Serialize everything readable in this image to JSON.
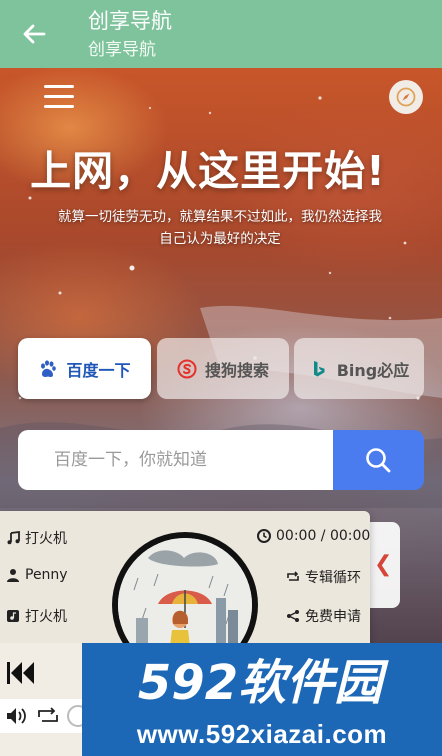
{
  "appbar": {
    "title": "创享导航",
    "subtitle": "创享导航"
  },
  "hero": {
    "headline": "上网，从这里开始!",
    "tagline": "就算一切徒劳无功，就算结果不过如此，我仍然选择我自己认为最好的决定"
  },
  "engines": [
    {
      "label": "百度一下",
      "icon": "baidu-paw-icon",
      "active": true
    },
    {
      "label": "搜狗搜索",
      "icon": "sogou-icon",
      "active": false
    },
    {
      "label": "Bing必应",
      "icon": "bing-icon",
      "active": false
    }
  ],
  "search": {
    "placeholder": "百度一下，你就知道",
    "value": ""
  },
  "player": {
    "song_title": "打火机",
    "artist": "Penny",
    "album": "打火机",
    "time": "00:00 / 00:00",
    "mode": "专辑循环",
    "share": "免费申请"
  },
  "watermark": {
    "logo": "592软件园",
    "url": "www.592xiazai.com"
  },
  "colors": {
    "appbar": "#7fc39c",
    "accent_blue": "#4a7cf0",
    "baidu_blue": "#1f56b8",
    "watermark_blue": "#1c68b6"
  }
}
